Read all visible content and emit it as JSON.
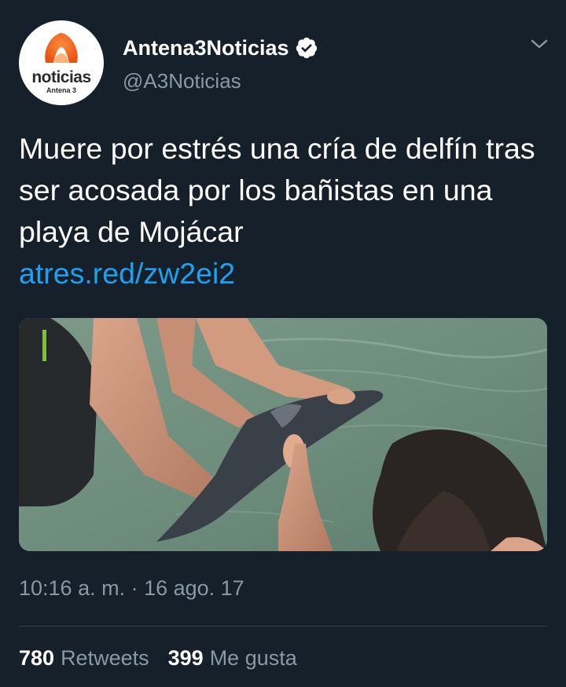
{
  "account": {
    "display_name": "Antena3Noticias",
    "handle": "@A3Noticias",
    "verified": true,
    "avatar": {
      "brand_text": "noticias",
      "sub_text": "Antena 3",
      "logo_color": "#f26522"
    }
  },
  "tweet": {
    "text": "Muere por estrés una cría de delfín tras ser acosada por los bañistas en una playa de Mojácar",
    "link": "atres.red/zw2ei2",
    "media": {
      "description_icon": "photo-bathers-touching-baby-dolphin"
    },
    "timestamp": "10:16 a. m. · 16 ago. 17"
  },
  "stats": {
    "retweets_count": "780",
    "retweets_label": "Retweets",
    "likes_count": "399",
    "likes_label": "Me gusta"
  },
  "colors": {
    "background": "#15202b",
    "text_primary": "#ffffff",
    "text_secondary": "#8899a6",
    "link": "#1da1f2",
    "divider": "#38444d"
  }
}
